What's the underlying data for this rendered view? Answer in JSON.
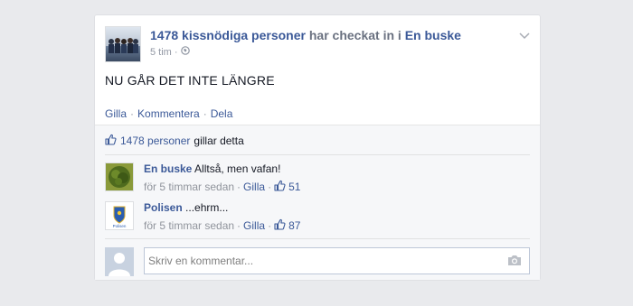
{
  "post": {
    "actor": "1478 kissnödiga personer",
    "verb": "har checkat in i",
    "place": "En buske",
    "time": "5 tim",
    "privacy_icon": "globe-icon",
    "text": "NU GÅR DET INTE LÄNGRE",
    "actions": {
      "like": "Gilla",
      "comment": "Kommentera",
      "share": "Dela"
    }
  },
  "feedback": {
    "likes_count_text": "1478 personer",
    "likes_suffix": "gillar detta",
    "comments": [
      {
        "author": "En buske",
        "text": "Alltså, men vafan!",
        "time": "för 5 timmar sedan",
        "like": "Gilla",
        "likes": "51"
      },
      {
        "author": "Polisen",
        "text": "...ehrm...",
        "time": "för 5 timmar sedan",
        "like": "Gilla",
        "likes": "87"
      }
    ],
    "composer_placeholder": "Skriv en kommentar..."
  },
  "colors": {
    "link": "#3b5998",
    "muted": "#9197a3",
    "background": "#e9eaed"
  }
}
